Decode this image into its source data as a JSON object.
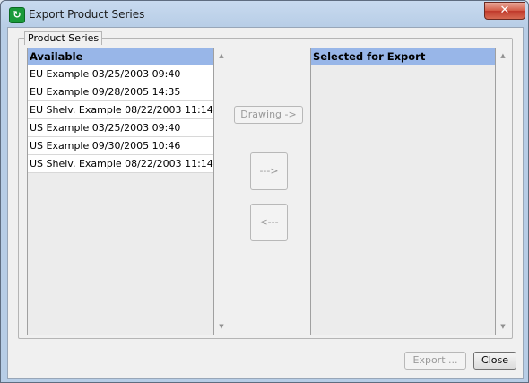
{
  "window": {
    "title": "Export Product Series",
    "close_label": "✕"
  },
  "group": {
    "legend": "Product Series"
  },
  "available": {
    "header": "Available",
    "items": [
      "EU Example  03/25/2003 09:40",
      "EU Example  09/28/2005 14:35",
      "EU Shelv. Example  08/22/2003 11:14",
      "US Example  03/25/2003 09:40",
      "US Example  09/30/2005 10:46",
      "US Shelv. Example  08/22/2003 11:14"
    ]
  },
  "selected": {
    "header": "Selected for Export",
    "items": []
  },
  "buttons": {
    "drawing": "Drawing ->",
    "add": "--->",
    "remove": "<---",
    "export": "Export ...",
    "close": "Close"
  },
  "icons": {
    "app": "export-app-icon",
    "scroll_up": "▲",
    "scroll_down": "▼"
  }
}
